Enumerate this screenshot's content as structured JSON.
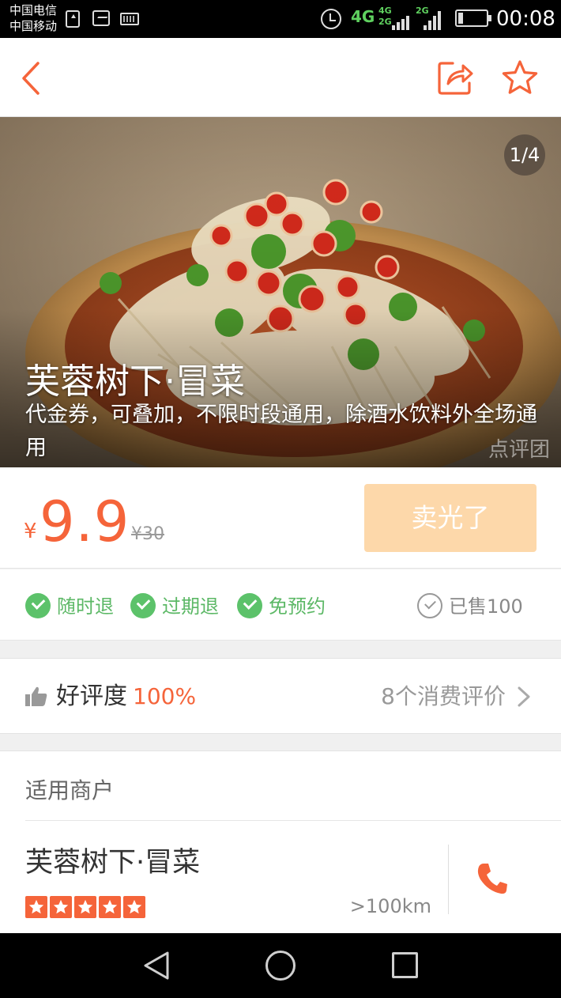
{
  "status_bar": {
    "carrier_1": "中国电信",
    "carrier_2": "中国移动",
    "network_main": "4G",
    "network_top": "4G",
    "network_bottom": "2G",
    "network_second": "2G",
    "time": "00:08",
    "icons": [
      "upload-icon",
      "image-icon",
      "keyboard-icon",
      "alarm-icon",
      "signal-icon",
      "battery-icon"
    ]
  },
  "header": {
    "back_icon": "chevron-left-icon",
    "share_icon": "share-icon",
    "favorite_icon": "star-icon"
  },
  "hero": {
    "image_counter": "1/4",
    "title": "芙蓉树下·冒菜",
    "description": "代金券，可叠加，不限时段通用，除酒水饮料外全场通用",
    "watermark": "点评团"
  },
  "price": {
    "currency": "¥",
    "current": "9.9",
    "original": "¥30",
    "button_label": "卖光了"
  },
  "features": {
    "items": [
      {
        "label": "随时退",
        "icon": "check-circle-icon"
      },
      {
        "label": "过期退",
        "icon": "check-circle-icon"
      },
      {
        "label": "免预约",
        "icon": "check-circle-icon"
      }
    ],
    "sold_text": "已售100"
  },
  "rating": {
    "label": "好评度",
    "value": "100%",
    "reviews_link": "8个消费评价"
  },
  "merchant": {
    "section_title": "适用商户",
    "name": "芙蓉树下·冒菜",
    "stars": 5,
    "distance": ">100km"
  },
  "colors": {
    "accent": "#f5643a",
    "success": "#5cc26a",
    "soldout_button": "#fdd8aa"
  }
}
